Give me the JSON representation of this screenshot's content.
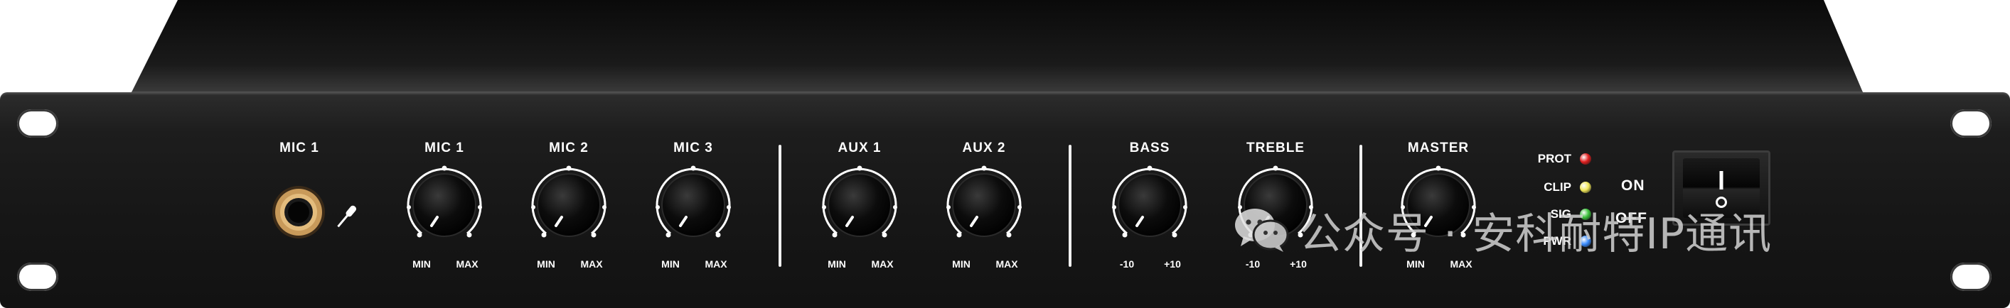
{
  "panel": {
    "inputs": {
      "jack_label": "MIC 1",
      "knobs": [
        {
          "label": "MIC 1",
          "min": "MIN",
          "max": "MAX"
        },
        {
          "label": "MIC 2",
          "min": "MIN",
          "max": "MAX"
        },
        {
          "label": "MIC 3",
          "min": "MIN",
          "max": "MAX"
        },
        {
          "label": "AUX 1",
          "min": "MIN",
          "max": "MAX"
        },
        {
          "label": "AUX 2",
          "min": "MIN",
          "max": "MAX"
        },
        {
          "label": "BASS",
          "min": "-10",
          "max": "+10"
        },
        {
          "label": "TREBLE",
          "min": "-10",
          "max": "+10"
        },
        {
          "label": "MASTER",
          "min": "MIN",
          "max": "MAX"
        }
      ]
    },
    "indicators": [
      {
        "label": "PROT",
        "color": "#e02020"
      },
      {
        "label": "CLIP",
        "color": "#f2e85a"
      },
      {
        "label": "SIG",
        "color": "#3ec43e"
      },
      {
        "label": "PWR",
        "color": "#3a8cff"
      }
    ],
    "power": {
      "on_label": "ON",
      "off_label": "OFF",
      "rocker_on_symbol": "I",
      "rocker_off_symbol": "O"
    }
  },
  "watermark": {
    "text": "公众号 · 安科耐特IP通讯",
    "icon": "wechat-icon"
  },
  "colors": {
    "panel": "#1a1a1a",
    "text": "#ffffff",
    "jack_ring": "#c89a5a"
  }
}
